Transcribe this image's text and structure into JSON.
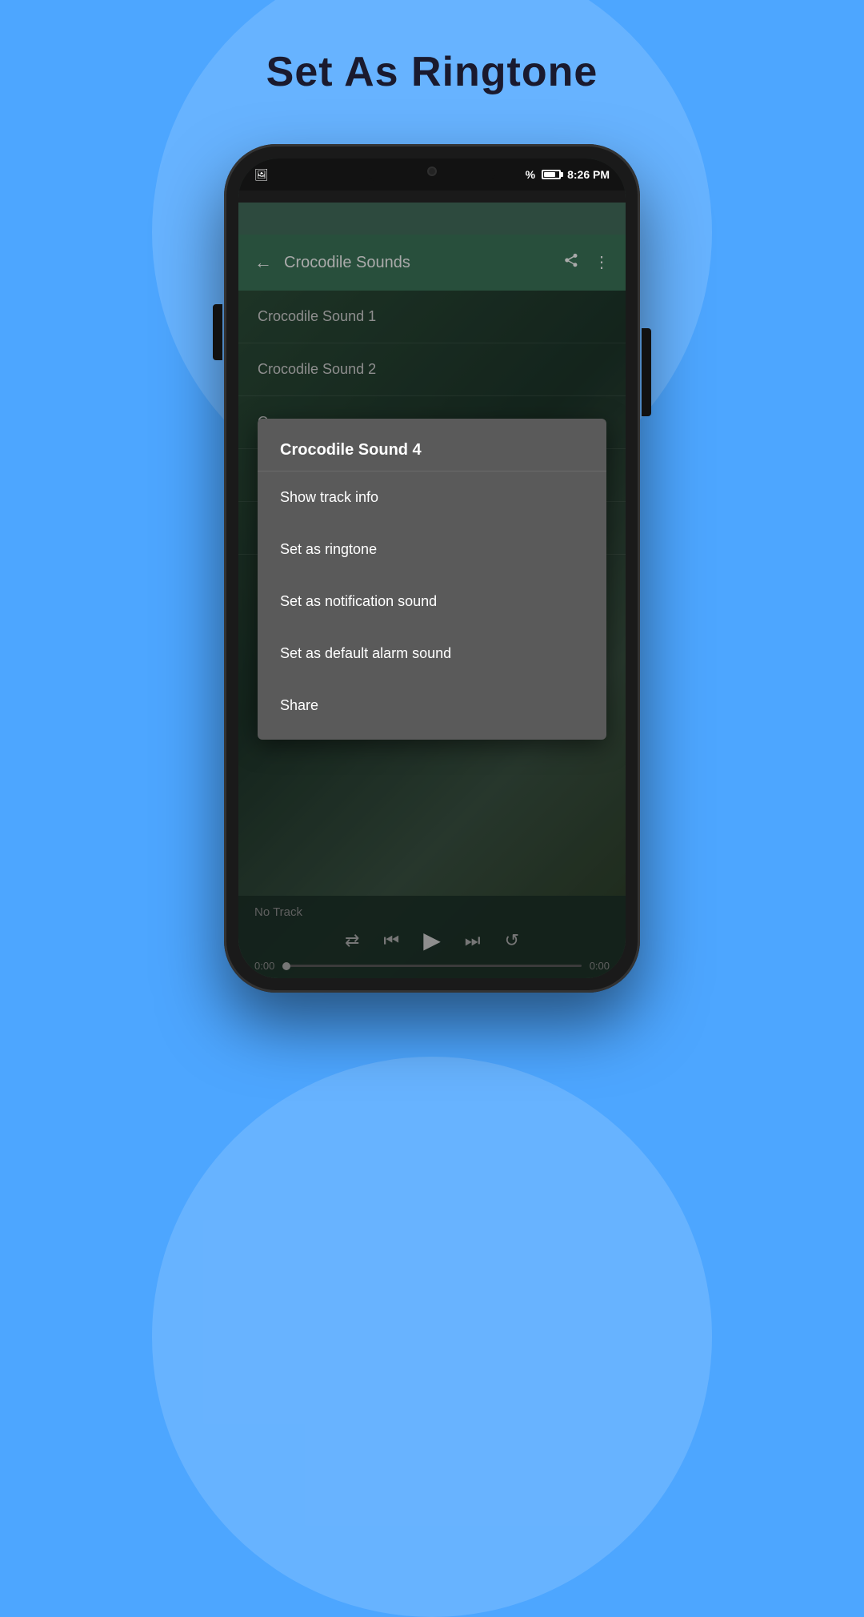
{
  "page": {
    "title": "Set As Ringtone",
    "background_color": "#4da6ff"
  },
  "status_bar": {
    "time": "8:26 PM",
    "battery_percent": "%",
    "icons": [
      "image-icon"
    ]
  },
  "app_bar": {
    "title": "Crocodile Sounds",
    "back_label": "←",
    "share_label": "share",
    "more_label": "⋮"
  },
  "sound_list": {
    "items": [
      {
        "label": "Crocodile Sound 1"
      },
      {
        "label": "Crocodile Sound 2"
      },
      {
        "label": "C..."
      },
      {
        "label": "C..."
      },
      {
        "label": "C..."
      }
    ]
  },
  "context_menu": {
    "title": "Crocodile Sound 4",
    "items": [
      {
        "label": "Show track info"
      },
      {
        "label": "Set as ringtone"
      },
      {
        "label": "Set as notification sound"
      },
      {
        "label": "Set as default alarm sound"
      },
      {
        "label": "Share"
      }
    ]
  },
  "player": {
    "no_track_label": "No Track",
    "time_start": "0:00",
    "time_end": "0:00",
    "controls": {
      "shuffle": "⇄",
      "prev": "⏮",
      "play": "▶",
      "next": "⏭",
      "repeat": "↺"
    }
  }
}
